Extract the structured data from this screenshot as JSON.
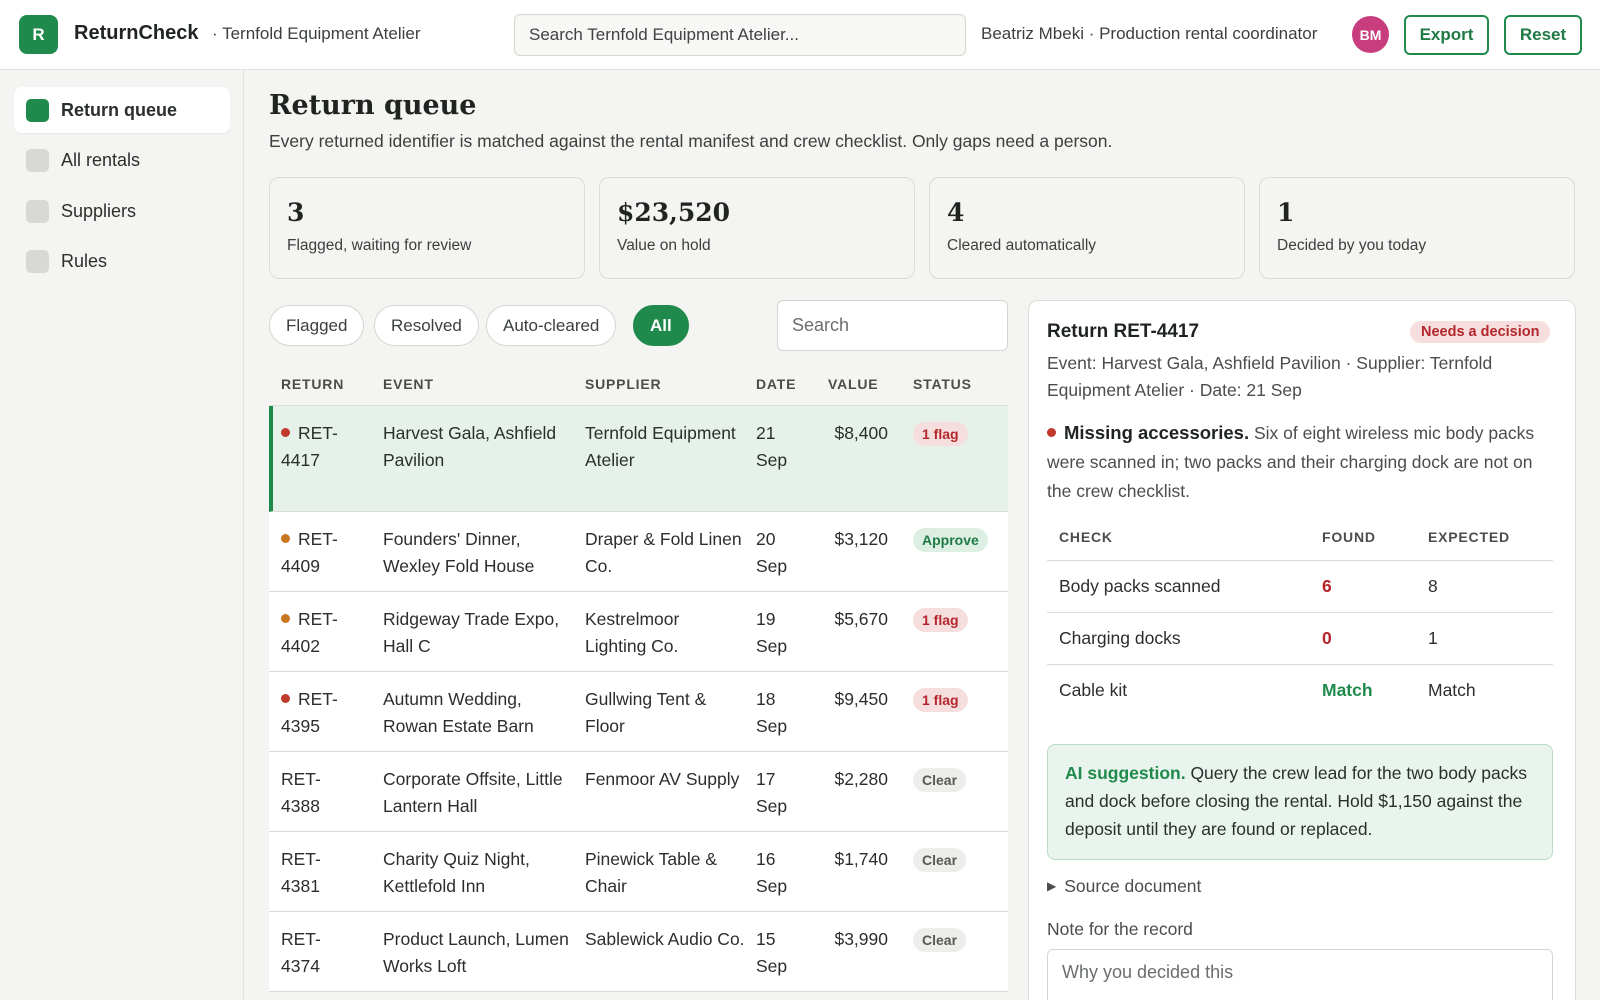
{
  "app": {
    "logo_letter": "R",
    "name": "ReturnCheck",
    "org": "· Ternfold Equipment Atelier",
    "search_placeholder": "Search Ternfold Equipment Atelier...",
    "user": "Beatriz Mbeki · Production rental coordinator",
    "avatar_initials": "BM",
    "export_label": "Export",
    "reset_label": "Reset",
    "brand_color": "#1f8a4c"
  },
  "sidebar": {
    "items": [
      {
        "label": "Return queue",
        "active": true
      },
      {
        "label": "All rentals",
        "active": false
      },
      {
        "label": "Suppliers",
        "active": false
      },
      {
        "label": "Rules",
        "active": false
      }
    ]
  },
  "page": {
    "title": "Return queue",
    "subtitle": "Every returned identifier is matched against the rental manifest and crew checklist. Only gaps need a person."
  },
  "stats": [
    {
      "value": "3",
      "label": "Flagged, waiting for review"
    },
    {
      "value": "$23,520",
      "label": "Value on hold"
    },
    {
      "value": "4",
      "label": "Cleared automatically"
    },
    {
      "value": "1",
      "label": "Decided by you today"
    }
  ],
  "filters": {
    "chips": [
      "Flagged",
      "Resolved",
      "Auto-cleared",
      "All"
    ],
    "active": "All",
    "search_placeholder": "Search"
  },
  "table": {
    "headers": [
      "RETURN",
      "EVENT",
      "SUPPLIER",
      "DATE",
      "VALUE",
      "STATUS"
    ],
    "rows": [
      {
        "ret": "RET-\n4417",
        "event": "Harvest Gala, Ashfield Pavilion",
        "supplier": "Ternfold Equipment Atelier",
        "date": "21 Sep",
        "value": "$8,400",
        "status": "1 flag",
        "kind": "flag",
        "dot": "#c0392b",
        "selected": true
      },
      {
        "ret": "RET-\n4409",
        "event": "Founders' Dinner, Wexley Fold House",
        "supplier": "Draper & Fold Linen Co.",
        "date": "20 Sep",
        "value": "$3,120",
        "status": "Approve",
        "kind": "approve",
        "dot": "#c8761e",
        "selected": false
      },
      {
        "ret": "RET-\n4402",
        "event": "Ridgeway Trade Expo, Hall C",
        "supplier": "Kestrelmoor Lighting Co.",
        "date": "19 Sep",
        "value": "$5,670",
        "status": "1 flag",
        "kind": "flag",
        "dot": "#c8761e",
        "selected": false
      },
      {
        "ret": "RET-\n4395",
        "event": "Autumn Wedding, Rowan Estate Barn",
        "supplier": "Gullwing Tent & Floor",
        "date": "18 Sep",
        "value": "$9,450",
        "status": "1 flag",
        "kind": "flag",
        "dot": "#c0392b",
        "selected": false
      },
      {
        "ret": "RET-\n4388",
        "event": "Corporate Offsite, Little Lantern Hall",
        "supplier": "Fenmoor AV Supply",
        "date": "17 Sep",
        "value": "$2,280",
        "status": "Clear",
        "kind": "clear",
        "dot": "",
        "selected": false
      },
      {
        "ret": "RET-\n4381",
        "event": "Charity Quiz Night, Kettlefold Inn",
        "supplier": "Pinewick Table & Chair",
        "date": "16 Sep",
        "value": "$1,740",
        "status": "Clear",
        "kind": "clear",
        "dot": "",
        "selected": false
      },
      {
        "ret": "RET-\n4374",
        "event": "Product Launch, Lumen Works Loft",
        "supplier": "Sablewick Audio Co.",
        "date": "15 Sep",
        "value": "$3,990",
        "status": "Clear",
        "kind": "clear",
        "dot": "",
        "selected": false
      }
    ]
  },
  "detail": {
    "title": "Return RET-4417",
    "badge": "Needs a decision",
    "meta": "Event: Harvest Gala, Ashfield Pavilion · Supplier: Ternfold Equipment Atelier · Date: 21 Sep",
    "issue_title": "Missing accessories.",
    "issue_text": "Six of eight wireless mic body packs were scanned in; two packs and their charging dock are not on the crew checklist.",
    "checks_headers": [
      "CHECK",
      "FOUND",
      "EXPECTED"
    ],
    "checks": [
      {
        "check": "Body packs scanned",
        "found": "6",
        "expected": "8",
        "ok": false
      },
      {
        "check": "Charging docks",
        "found": "0",
        "expected": "1",
        "ok": false
      },
      {
        "check": "Cable kit",
        "found": "Match",
        "expected": "Match",
        "ok": true
      }
    ],
    "ai_title": "AI suggestion.",
    "ai_text": "Query the crew lead for the two body packs and dock before closing the rental. Hold $1,150 against the deposit until they are found or replaced.",
    "source_label": "Source document",
    "note_label": "Note for the record",
    "note_placeholder": "Why you decided this"
  }
}
